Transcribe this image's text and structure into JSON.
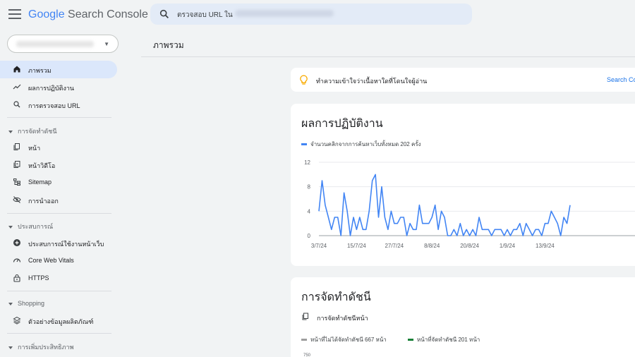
{
  "app": {
    "logo_google": "Google",
    "logo_rest": " Search Console",
    "search_placeholder": "ตรวจสอบ URL ใน"
  },
  "sidebar": {
    "items_top": [
      {
        "label": "ภาพรวม",
        "icon": "home-icon",
        "active": true
      },
      {
        "label": "ผลการปฏิบัติงาน",
        "icon": "trending-icon",
        "active": false
      },
      {
        "label": "การตรวจสอบ URL",
        "icon": "search-icon",
        "active": false
      }
    ],
    "section_index": "การจัดทำดัชนี",
    "items_index": [
      {
        "label": "หน้า",
        "icon": "pages-icon"
      },
      {
        "label": "หน้าวิดีโอ",
        "icon": "video-pages-icon"
      },
      {
        "label": "Sitemap",
        "icon": "sitemap-icon"
      },
      {
        "label": "การนำออก",
        "icon": "removals-icon"
      }
    ],
    "section_experience": "ประสบการณ์",
    "items_experience": [
      {
        "label": "ประสบการณ์ใช้งานหน้าเว็บ",
        "icon": "plus-circle-icon"
      },
      {
        "label": "Core Web Vitals",
        "icon": "gauge-icon"
      },
      {
        "label": "HTTPS",
        "icon": "lock-icon"
      }
    ],
    "section_shopping": "Shopping",
    "items_shopping": [
      {
        "label": "ตัวอย่างข้อมูลผลิตภัณฑ์",
        "icon": "layers-icon"
      }
    ],
    "section_enhancements": "การเพิ่มประสิทธิภาพ"
  },
  "main": {
    "page_title": "ภาพรวม",
    "banner_text": "ทำความเข้าใจว่าเนื้อหาใดที่โดนใจผู้อ่าน",
    "banner_link": "Search Co",
    "performance": {
      "title": "ผลการปฏิบัติงาน",
      "legend": "จำนวนคลิกจากการค้นหาเว็บทั้งหมด 202 ครั้ง",
      "color": "#4285f4"
    },
    "indexing": {
      "title": "การจัดทำดัชนี",
      "sub_label": "การจัดทำดัชนีหน้า",
      "legend_not_indexed": "หน้าที่ไม่ได้จัดทำดัชนี 667 หน้า",
      "legend_indexed": "หน้าที่จัดทำดัชนี 201 หน้า",
      "color_not_indexed": "#9e9e9e",
      "color_indexed": "#188038",
      "axis_top": "750"
    }
  },
  "chart_data": {
    "type": "line",
    "title": "ผลการปฏิบัติงาน",
    "series": [
      {
        "name": "จำนวนคลิกจากการค้นหาเว็บทั้งหมด 202 ครั้ง",
        "values": [
          4,
          9,
          5,
          3,
          1,
          3,
          3,
          0,
          7,
          4,
          0,
          3,
          1,
          3,
          1,
          1,
          4,
          9,
          10,
          3,
          8,
          3,
          1,
          4,
          2,
          2,
          3,
          3,
          0,
          2,
          1,
          1,
          5,
          2,
          2,
          2,
          3,
          5,
          1,
          4,
          3,
          0,
          0,
          1,
          0,
          2,
          0,
          1,
          0,
          1,
          0,
          3,
          1,
          1,
          1,
          0,
          1,
          1,
          1,
          0,
          1,
          0,
          1,
          1,
          2,
          0,
          2,
          1,
          0,
          1,
          1,
          0,
          2,
          2,
          4,
          3,
          2,
          0,
          3,
          2,
          5
        ]
      }
    ],
    "x_tick_labels": [
      "3/7/24",
      "15/7/24",
      "27/7/24",
      "8/8/24",
      "20/8/24",
      "1/9/24",
      "13/9/24"
    ],
    "y_ticks": [
      0,
      4,
      8,
      12
    ],
    "ylim": [
      0,
      12
    ],
    "grid": true
  }
}
